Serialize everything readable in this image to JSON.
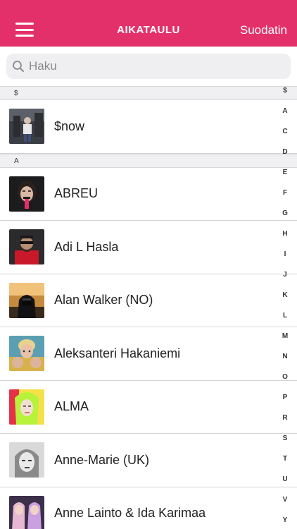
{
  "header": {
    "title": "AIKATAULU",
    "filter_label": "Suodatin",
    "brand_color": "#e3306b"
  },
  "search": {
    "placeholder": "Haku"
  },
  "sections": [
    {
      "letter": "$",
      "artists": [
        {
          "name": "$now",
          "image": "photo-dark-street"
        }
      ]
    },
    {
      "letter": "A",
      "artists": [
        {
          "name": "ABREU",
          "image": "photo-portrait-dark-hair"
        },
        {
          "name": "Adi L Hasla",
          "image": "photo-red-jacket"
        },
        {
          "name": "Alan Walker (NO)",
          "image": "photo-masked-sunset"
        },
        {
          "name": "Aleksanteri Hakaniemi",
          "image": "photo-blond-hands"
        },
        {
          "name": "ALMA",
          "image": "photo-green-hair"
        },
        {
          "name": "Anne-Marie (UK)",
          "image": "photo-bw-portrait"
        },
        {
          "name": "Anne Lainto & Ida Karimaa",
          "image": "photo-duo-pink"
        }
      ]
    }
  ],
  "index": [
    "$",
    "A",
    "C",
    "D",
    "E",
    "F",
    "G",
    "H",
    "I",
    "J",
    "K",
    "L",
    "M",
    "N",
    "O",
    "P",
    "R",
    "S",
    "T",
    "U",
    "V",
    "Y"
  ]
}
